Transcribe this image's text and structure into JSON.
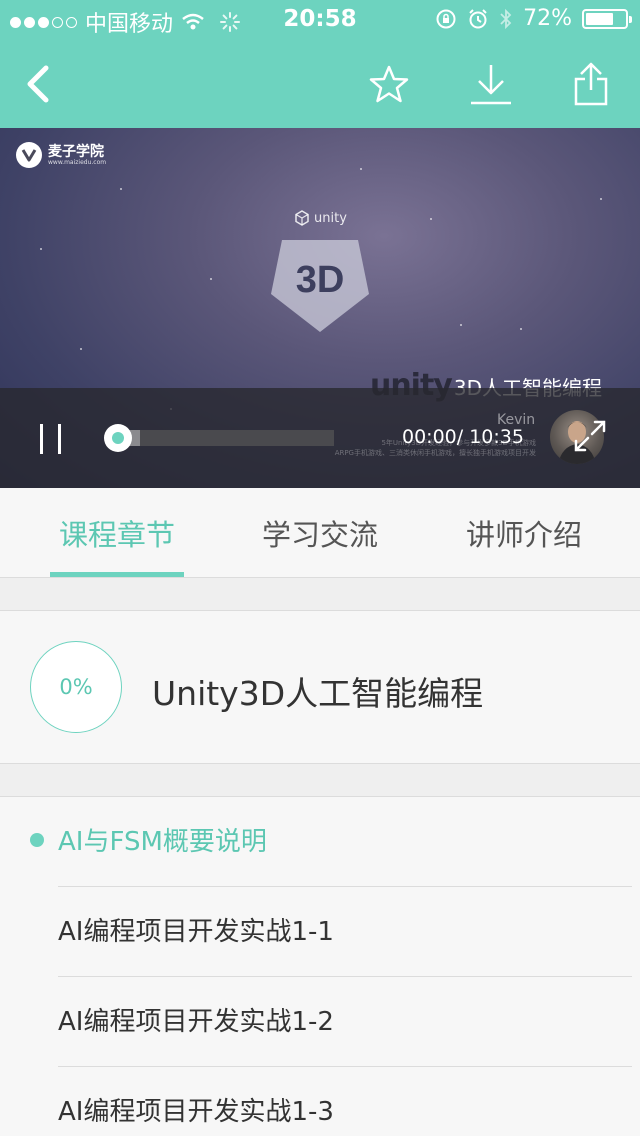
{
  "status_bar": {
    "carrier": "中国移动",
    "time": "20:58",
    "battery_percent": "72%",
    "battery_level": 0.72,
    "signal_bars_filled": 3,
    "signal_bars_total": 5
  },
  "nav": {
    "back_icon": "chevron-left-icon",
    "favorite_icon": "star-icon",
    "download_icon": "download-icon",
    "share_icon": "share-icon"
  },
  "video": {
    "brand_name": "麦子学院",
    "brand_url": "www.maiziedu.com",
    "unity_logo_text": "unity",
    "badge_text": "3D",
    "title_word": "unity",
    "title_suffix": "3D人工智能编程",
    "presenter": "Kevin",
    "caption_line1": "5年Unity3D开发经验，参与开发多款3D手机游戏",
    "caption_line2": "ARPG手机游戏、三消类休闲手机游戏，擅长独手机游戏项目开发",
    "current_time": "00:00",
    "duration": "/ 10:35",
    "played_fraction": 0.0,
    "buffered_fraction": 0.1
  },
  "tabs": [
    {
      "label": "课程章节",
      "active": true
    },
    {
      "label": "学习交流",
      "active": false
    },
    {
      "label": "讲师介绍",
      "active": false
    }
  ],
  "course": {
    "progress_label": "0%",
    "title": "Unity3D人工智能编程"
  },
  "chapters": [
    {
      "label": "AI与FSM概要说明",
      "current": true
    },
    {
      "label": "AI编程项目开发实战1-1",
      "current": false
    },
    {
      "label": "AI编程项目开发实战1-2",
      "current": false
    },
    {
      "label": "AI编程项目开发实战1-3",
      "current": false
    }
  ],
  "colors": {
    "accent": "#6dd3bf",
    "accent_text": "#5cc7b2"
  }
}
